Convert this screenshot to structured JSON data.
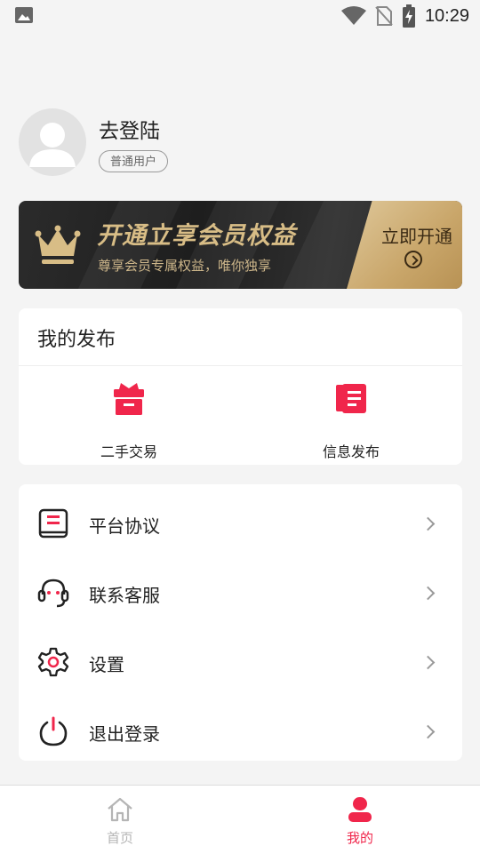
{
  "status_bar": {
    "time": "10:29"
  },
  "profile": {
    "username": "去登陆",
    "badge": "普通用户"
  },
  "vip_banner": {
    "title": "开通立享会员权益",
    "subtitle": "尊享会员专属权益，唯你独享",
    "cta_label": "立即开通",
    "accent": "#d8bd86"
  },
  "publish": {
    "title": "我的发布",
    "items": [
      {
        "label": "二手交易",
        "icon": "gift-box-icon"
      },
      {
        "label": "信息发布",
        "icon": "newspaper-icon"
      }
    ]
  },
  "menu": {
    "items": [
      {
        "label": "平台协议",
        "icon": "document-icon"
      },
      {
        "label": "联系客服",
        "icon": "headset-icon"
      },
      {
        "label": "设置",
        "icon": "gear-icon"
      },
      {
        "label": "退出登录",
        "icon": "power-icon"
      }
    ]
  },
  "bottom_nav": {
    "items": [
      {
        "label": "首页",
        "icon": "home-icon",
        "active": false
      },
      {
        "label": "我的",
        "icon": "user-icon",
        "active": true
      }
    ],
    "active_color": "#f0264b",
    "inactive_color": "#b5b5b5"
  }
}
